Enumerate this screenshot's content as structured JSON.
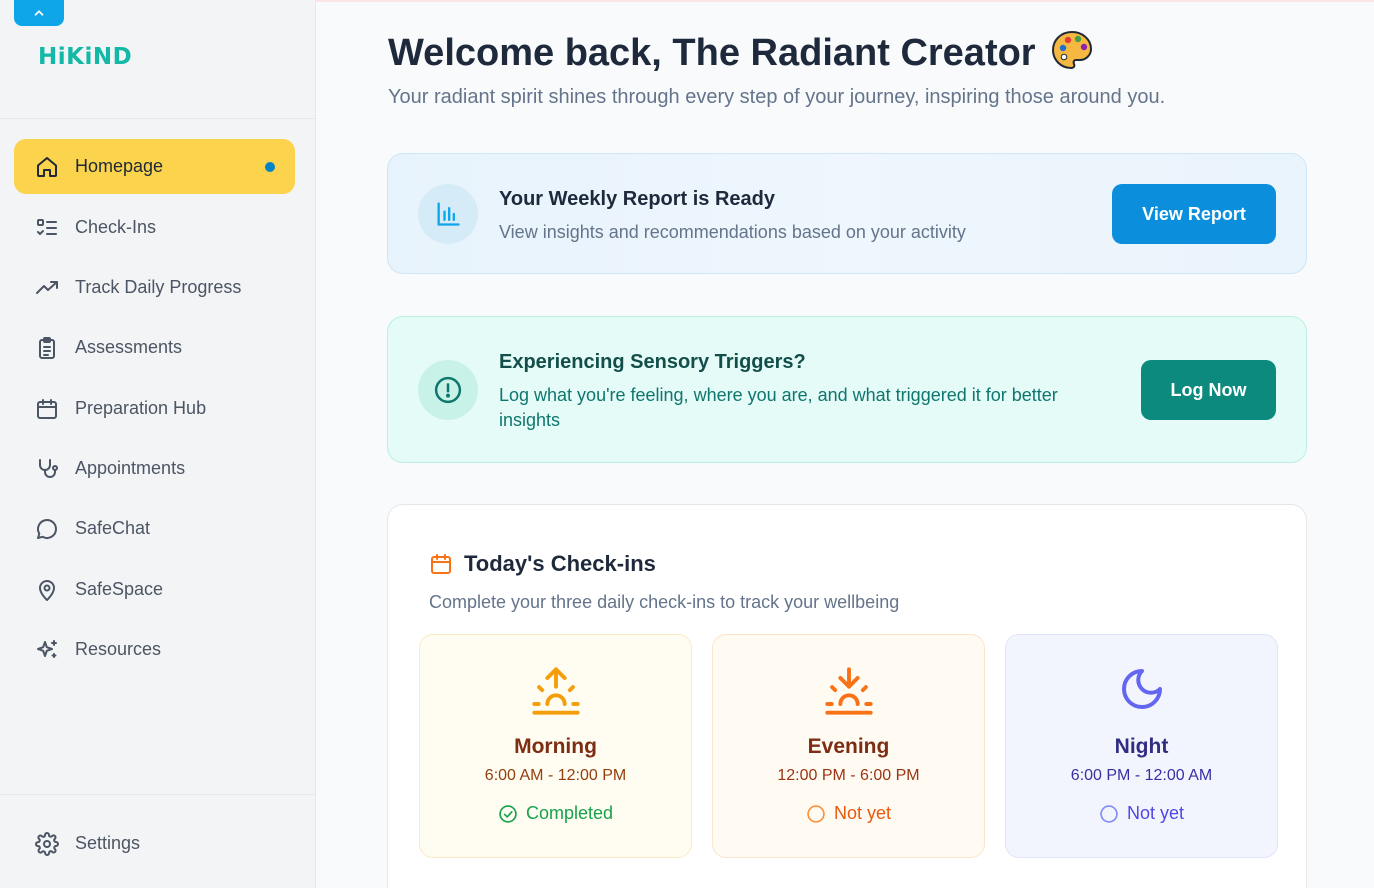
{
  "app": {
    "logo": "HiKiND"
  },
  "sidebar": {
    "items": [
      {
        "label": "Homepage",
        "icon": "home-icon",
        "active": true
      },
      {
        "label": "Check-Ins",
        "icon": "checklist-icon"
      },
      {
        "label": "Track Daily Progress",
        "icon": "trending-up-icon"
      },
      {
        "label": "Assessments",
        "icon": "clipboard-icon"
      },
      {
        "label": "Preparation Hub",
        "icon": "calendar-icon"
      },
      {
        "label": "Appointments",
        "icon": "stethoscope-icon"
      },
      {
        "label": "SafeChat",
        "icon": "chat-bubble-icon"
      },
      {
        "label": "SafeSpace",
        "icon": "map-pin-icon"
      },
      {
        "label": "Resources",
        "icon": "sparkles-icon"
      }
    ],
    "settings": {
      "label": "Settings",
      "icon": "gear-icon"
    }
  },
  "header": {
    "title": "Welcome back, The Radiant Creator",
    "emoji": "🎨",
    "subtitle": "Your radiant spirit shines through every step of your journey, inspiring those around you."
  },
  "report": {
    "heading": "Your Weekly Report is Ready",
    "description": "View insights and recommendations based on your activity",
    "button": "View Report",
    "icon": "bar-chart-icon"
  },
  "triggers": {
    "heading": "Experiencing Sensory Triggers?",
    "description": "Log what you're feeling, where you are, and what triggered it for better insights",
    "button": "Log Now",
    "icon": "alert-circle-icon"
  },
  "checkins": {
    "title": "Today's Check-ins",
    "description": "Complete your three daily check-ins to track your wellbeing",
    "slots": [
      {
        "name": "Morning",
        "time": "6:00 AM - 12:00 PM",
        "status": "Completed",
        "icon": "sunrise-icon"
      },
      {
        "name": "Evening",
        "time": "12:00 PM - 6:00 PM",
        "status": "Not yet",
        "icon": "sunset-icon"
      },
      {
        "name": "Night",
        "time": "6:00 PM - 12:00 AM",
        "status": "Not yet",
        "icon": "moon-icon"
      }
    ]
  },
  "colors": {
    "accent": "#0ea5e9",
    "active_nav": "#fcd34d",
    "teal_button": "#0d9488",
    "report_button": "#0284c7"
  }
}
